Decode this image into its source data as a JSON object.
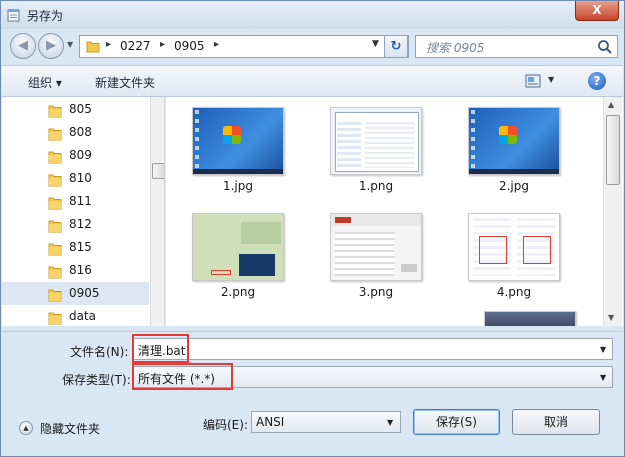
{
  "window": {
    "title": "另存为",
    "close_label": "X"
  },
  "nav": {
    "back_label": "◀",
    "forward_label": "▶",
    "breadcrumb": [
      "0227",
      "0905"
    ],
    "refresh_label": "↻",
    "search_placeholder": "搜索 0905"
  },
  "toolbar": {
    "organize_label": "组织 ▾",
    "new_folder_label": "新建文件夹",
    "help_label": "?"
  },
  "tree": {
    "items": [
      {
        "label": "805"
      },
      {
        "label": "808"
      },
      {
        "label": "809"
      },
      {
        "label": "810"
      },
      {
        "label": "811"
      },
      {
        "label": "812"
      },
      {
        "label": "815"
      },
      {
        "label": "816"
      },
      {
        "label": "0905",
        "selected": true
      },
      {
        "label": "data"
      }
    ]
  },
  "files": [
    {
      "name": "1.jpg",
      "kind": "desktop"
    },
    {
      "name": "1.png",
      "kind": "window"
    },
    {
      "name": "2.jpg",
      "kind": "desktop"
    },
    {
      "name": "2.png",
      "kind": "greenui"
    },
    {
      "name": "3.png",
      "kind": "phoenix"
    },
    {
      "name": "4.png",
      "kind": "tree"
    }
  ],
  "form": {
    "filename_label": "文件名(N):",
    "filename_value": "清理.bat",
    "filetype_label": "保存类型(T):",
    "filetype_value": "所有文件  (*.*)",
    "encoding_label": "编码(E):",
    "encoding_value": "ANSI"
  },
  "footer": {
    "hide_folders_label": "隐藏文件夹",
    "save_label": "保存(S)",
    "cancel_label": "取消"
  },
  "colors": {
    "highlight_border": "#e53935",
    "selected_bg": "#dde7f3"
  }
}
